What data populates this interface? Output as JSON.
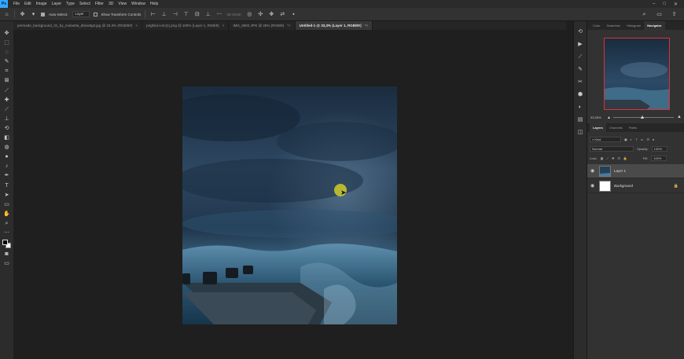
{
  "app": {
    "logo": "Ps"
  },
  "menu": [
    "File",
    "Edit",
    "Image",
    "Layer",
    "Type",
    "Select",
    "Filter",
    "3D",
    "View",
    "Window",
    "Help"
  ],
  "window_controls": {
    "minimize": "–",
    "maximize": "□",
    "close": "✕"
  },
  "options": {
    "auto_select_label": "Auto-Select:",
    "auto_select_value": "Layer",
    "transform_label": "Show Transform Controls",
    "mode_label": "3D Mode:"
  },
  "tabs": [
    {
      "label": "premade_background_31_by_mulan8a_d6ow5g2.jpg @ 33,3% (RGB/8#)",
      "close": "×",
      "active": false
    },
    {
      "label": "pngfind.com(1).png @ 100% (Layer 1, RGB/8)",
      "close": "×",
      "active": false
    },
    {
      "label": "IMG_5902.JPG @ 25% (RGB/8)",
      "close": "*×",
      "active": false
    },
    {
      "label": "Untitled-1 @ 33,3% (Layer 1, RGB/8#)",
      "close": "*×",
      "active": true
    }
  ],
  "navigator": {
    "tabs": [
      "Color",
      "Swatches",
      "Histogram",
      "Navigator"
    ],
    "active_tab": "Navigator",
    "zoom": "33,33%",
    "zoom_level": 0.46
  },
  "layers": {
    "tabs": [
      "Layers",
      "Channels",
      "Paths"
    ],
    "active_tab": "Layers",
    "filter": "Kind",
    "blend_mode": "Normal",
    "opacity_label": "Opacity:",
    "opacity": "100%",
    "lock_label": "Lock:",
    "fill_label": "Fill:",
    "fill": "100%",
    "items": [
      {
        "name": "Layer 1",
        "selected": true,
        "italic": false,
        "locked": false
      },
      {
        "name": "Background",
        "selected": false,
        "italic": true,
        "locked": true
      }
    ]
  },
  "colors": {
    "accent": "#31a8ff",
    "navigator_frame": "#e03030",
    "cursor": "#d6d028"
  }
}
